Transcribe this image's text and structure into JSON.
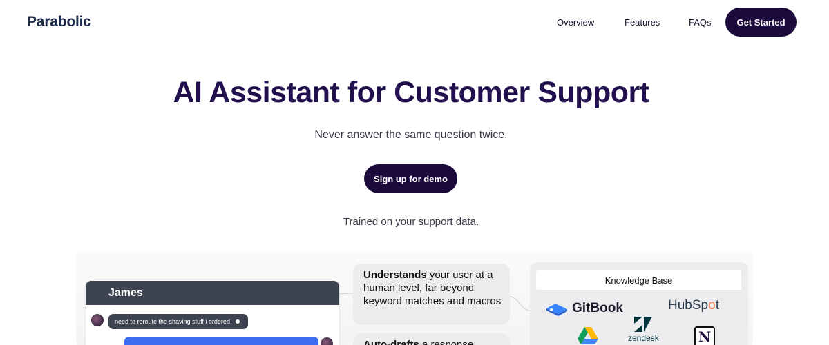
{
  "header": {
    "logo": "Parabolic",
    "nav": [
      "Overview",
      "Features",
      "FAQs"
    ],
    "cta": "Get Started"
  },
  "hero": {
    "title": "AI Assistant for Customer Support",
    "subtitle": "Never answer the same question twice.",
    "demo_button": "Sign up for demo",
    "trained_note": "Trained on your support data."
  },
  "chat": {
    "name": "James",
    "message": "need to reroute the shaving stuff i ordered"
  },
  "features": [
    {
      "bold": "Understands",
      "rest": " your user at a human level, far beyond keyword matches and macros"
    },
    {
      "bold": "Auto-drafts",
      "rest": " a response"
    }
  ],
  "knowledge_base": {
    "title": "Knowledge Base",
    "gitbook": "GitBook",
    "hubspot_prefix": "HubSp",
    "hubspot_o": "o",
    "hubspot_suffix": "t",
    "zendesk": "zendesk",
    "notion_letter": "N"
  },
  "colors": {
    "brand_dark": "#1d0a3d",
    "title_purple": "#21104d",
    "chat_header": "#3d4351",
    "chat_blue": "#3d6df0",
    "hubspot_orange": "#ff7a59"
  }
}
